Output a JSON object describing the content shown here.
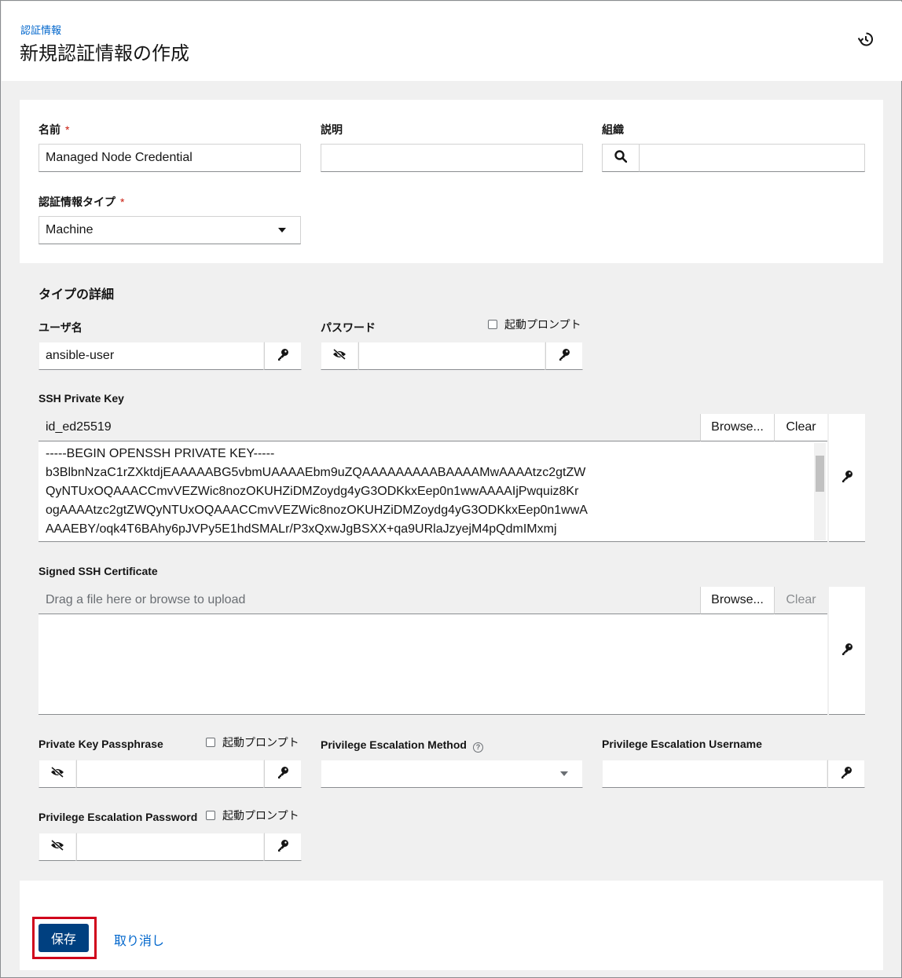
{
  "header": {
    "breadcrumb": "認証情報",
    "title": "新規認証情報の作成",
    "history_icon": "history-icon"
  },
  "form": {
    "name_label": "名前",
    "required_mark": "*",
    "name_value": "Managed Node Credential",
    "description_label": "説明",
    "description_value": "",
    "organization_label": "組織",
    "organization_value": "",
    "credential_type_label": "認証情報タイプ",
    "credential_type_value": "Machine"
  },
  "type_details": {
    "title": "タイプの詳細",
    "username_label": "ユーザ名",
    "username_value": "ansible-user",
    "password_label": "パスワード",
    "prompt_on_launch": "起動プロンプト",
    "ssh_key_label": "SSH Private Key",
    "ssh_key_filename": "id_ed25519",
    "browse_label": "Browse...",
    "clear_label": "Clear",
    "ssh_key_content": "-----BEGIN OPENSSH PRIVATE KEY-----\nb3BlbnNzaC1rZXktdjEAAAAABG5vbmUAAAAEbm9uZQAAAAAAAAABAAAAMwAAAAtzc2gtZW\nQyNTUxOQAAACCmvVEZWic8nozOKUHZiDMZoydg4yG3ODKkxEep0n1wwAAAAIjPwquiz8Kr\nogAAAAtzc2gtZWQyNTUxOQAAACCmvVEZWic8nozOKUHZiDMZoydg4yG3ODKkxEep0n1wwA\nAAAEBY/oqk4T6BAhy6pJVPy5E1hdSMALr/P3xQxwJgBSXX+qa9URlaJzyejM4pQdmIMxmj",
    "signed_cert_label": "Signed SSH Certificate",
    "signed_cert_placeholder": "Drag a file here or browse to upload",
    "passphrase_label": "Private Key Passphrase",
    "priv_esc_method_label": "Privilege Escalation Method",
    "priv_esc_method_help": "?",
    "priv_esc_username_label": "Privilege Escalation Username",
    "priv_esc_password_label": "Privilege Escalation Password"
  },
  "actions": {
    "save_label": "保存",
    "cancel_label": "取り消し"
  },
  "colors": {
    "primary": "#004080",
    "link": "#0066cc",
    "required": "#c9190b",
    "highlight": "#d0021b"
  }
}
